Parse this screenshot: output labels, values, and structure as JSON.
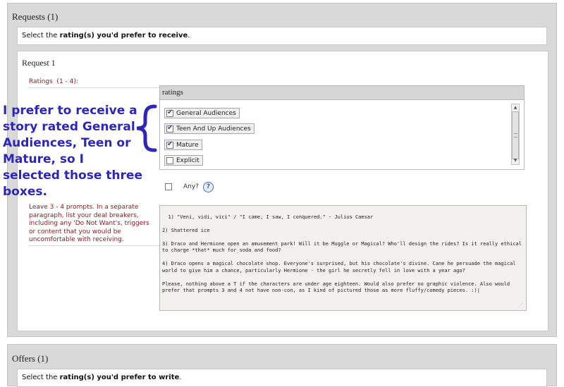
{
  "requests": {
    "title": "Requests (1)",
    "instruction_prefix": "Select the ",
    "instruction_bold": "rating(s) you'd prefer to receive",
    "instruction_suffix": ".",
    "request": {
      "title": "Request 1",
      "ratings_label": "Ratings  (1 - 4):",
      "ratings_header": "ratings",
      "ratings": [
        {
          "label": "General Audiences",
          "checked": true
        },
        {
          "label": "Teen And Up Audiences",
          "checked": true
        },
        {
          "label": "Mature",
          "checked": true
        },
        {
          "label": "Explicit",
          "checked": false
        }
      ],
      "any_label": "Any?",
      "help_symbol": "?",
      "prompts_label": "Leave 3 - 4 prompts. In a separate paragraph, list your deal breakers, including any 'Do Not Want's, triggers or content that you would be uncomfortable with receiving.",
      "prompts_text": "1) \"Veni, vidi, vici\" / \"I came, I saw, I conquered.\" - Julius Caesar\n\n2) Shattered ice\n\n3) Draco and Hermione open an amusement park! Will it be Muggle or Magical? Who'll design the rides? Is it really ethical to charge *that* much for soda and food?\n\n4) Draco opens a magical chocolate shop. Everyone's surprised, but his chocolate's divine. Cane he persuade the magical world to give him a chance, particularly Hermione - the girl he secretly fell in love with a year ago?\n\nPlease, nothing above a T if the characters are under age eighteen. Would also prefer no graphic violence. Also would prefer that prompts 3 and 4 not have non-con, as I kind of pictured those as more fluffy/comedy pieces. :)|"
    }
  },
  "offers": {
    "title": "Offers (1)",
    "instruction_prefix": "Select the ",
    "instruction_bold": "rating(s) you'd prefer to write",
    "instruction_suffix": "."
  },
  "annotation": {
    "text": "I prefer to receive a story rated General Audiences, Teen or Mature, so I selected those three boxes.",
    "color": "#2d27b8"
  },
  "colors": {
    "label_red": "#8b1a1a",
    "panel_gray": "#d9d9d9"
  }
}
